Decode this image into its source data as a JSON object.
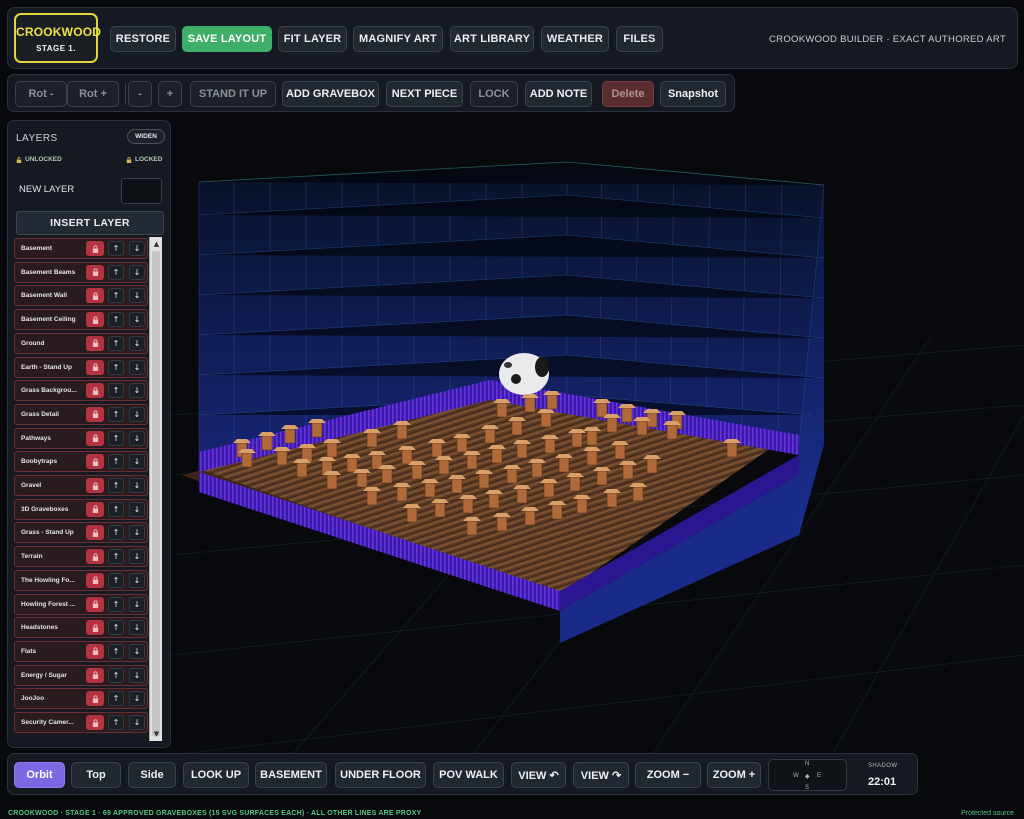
{
  "brand": {
    "title": "CROOKWOOD",
    "stage": "STAGE 1."
  },
  "header": {
    "buttons": [
      "RESTORE",
      "SAVE LAYOUT",
      "FIT LAYER",
      "MAGNIFY ART",
      "ART LIBRARY",
      "WEATHER",
      "FILES"
    ],
    "right_text": "CROOKWOOD BUILDER · EXACT AUTHORED ART",
    "accent_green": "#3daf68"
  },
  "toolbar": {
    "rot_minus": "Rot -",
    "rot_plus": "Rot +",
    "minus": "-",
    "plus": "+",
    "stand_it_up": "STAND IT UP",
    "add_gravebox": "ADD GRAVEBOX",
    "next_piece": "NEXT PIECE",
    "lock": "LOCK",
    "add_note": "ADD NOTE",
    "delete": "Delete",
    "snapshot": "Snapshot"
  },
  "layers": {
    "title": "LAYERS",
    "widen": "WIDEN",
    "unlocked": "UNLOCKED",
    "locked": "LOCKED",
    "new_layer_label": "NEW LAYER",
    "new_layer_value": "",
    "insert_label": "INSERT LAYER",
    "up_arrow": "↑",
    "down_arrow": "↓",
    "items": [
      "Basement",
      "Basement Beams",
      "Basement Wall",
      "Basement Ceiling",
      "Ground",
      "Earth - Stand Up",
      "Grass Backgrou...",
      "Grass Detail",
      "Pathways",
      "Boobytraps",
      "Gravel",
      "3D Graveboxes",
      "Grass - Stand Up",
      "Terrain",
      "The Howling Fo...",
      "Howling Forest ...",
      "Headstones",
      "Flats",
      "Energy / Sugar",
      "JooJoo",
      "Security Camer..."
    ],
    "lock_color": "#b3343e"
  },
  "nav": {
    "buttons": [
      "Orbit",
      "Top",
      "Side",
      "LOOK UP",
      "BASEMENT",
      "UNDER FLOOR",
      "POV WALK",
      "VIEW ↶",
      "VIEW ↷",
      "ZOOM −",
      "ZOOM +"
    ],
    "active": "Orbit",
    "active_color": "#7c68e3",
    "compass": {
      "n": "N",
      "s": "S",
      "w": "W",
      "e": "E",
      "center": "◆"
    },
    "shadow_label": "SHADOW",
    "shadow_time": "22:01"
  },
  "status": {
    "text": "CROOKWOOD · STAGE 1 · 69 APPROVED GRAVEBOXES (15 SVG SURFACES EACH) · ALL OTHER LINES ARE PROXY",
    "protected": "Protected source",
    "status_color": "#57c785"
  }
}
